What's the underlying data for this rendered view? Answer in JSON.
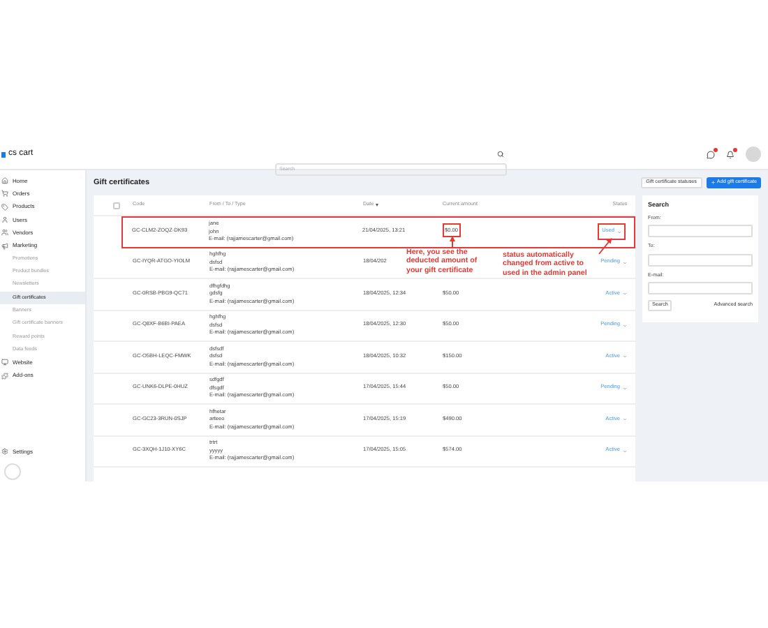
{
  "header": {
    "logo_text": "cs cart",
    "search": {
      "placeholder": "Search"
    }
  },
  "sidebar": {
    "items": [
      {
        "label": "Home",
        "selected": false
      },
      {
        "label": "Orders",
        "selected": false
      },
      {
        "label": "Products",
        "selected": false
      },
      {
        "label": "Users",
        "selected": false
      },
      {
        "label": "Vendors",
        "selected": false
      },
      {
        "label": "Marketing",
        "selected": false,
        "children": [
          {
            "label": "Promotions",
            "selected": false
          },
          {
            "label": "Product bundles",
            "selected": false
          },
          {
            "label": "Newsletters",
            "selected": false
          },
          {
            "label": "Gift certificates",
            "selected": true
          },
          {
            "label": "Banners",
            "selected": false
          },
          {
            "label": "Gift certificate banners",
            "selected": false
          },
          {
            "label": "Reward points",
            "selected": false
          },
          {
            "label": "Data feeds",
            "selected": false
          }
        ]
      },
      {
        "label": "Website",
        "selected": false
      },
      {
        "label": "Add-ons",
        "selected": false
      }
    ],
    "settings": {
      "label": "Settings"
    }
  },
  "page": {
    "title": "Gift certificates",
    "buttons": [
      {
        "label": "Gift certificate statuses",
        "kind": "secondary"
      },
      {
        "label": "Add gift certificate",
        "kind": "primary"
      }
    ]
  },
  "table": {
    "select_all": {
      "checked": false
    },
    "columns": [
      "Code",
      "From / To / Type",
      "Date",
      "Current amount",
      "Status"
    ],
    "rows": [
      {
        "code": "GC-CLM2-ZOQZ-DK93",
        "from": "jane",
        "to": "john",
        "type": "E-mail: (rajjamescarter@gmail.com)",
        "date": "21/04/2025, 13:21",
        "amount": "$0.00",
        "status": "Used",
        "marked": true
      },
      {
        "code": "GC-IYQR-ATGO-YIOLM",
        "from": "hghfhg",
        "to": "dsfsd",
        "type": "E-mail: (rajjamescarter@gmail.com)",
        "date": "18/04/202",
        "status": "Pending",
        "marked": false
      },
      {
        "code": "GC-0RSB-PBG9-QC71",
        "from": "dfhgfdhg",
        "to": "gdsfg",
        "type": "E-mail: (rajjamescarter@gmail.com)",
        "date": "18/04/2025, 12:34",
        "amount": "$50.00",
        "status": "Active",
        "marked": false
      },
      {
        "code": "GC-Q8XF-B6BI-PAEA",
        "from": "hghfhg",
        "to": "dsfsd",
        "type": "E-mail: (rajjamescarter@gmail.com)",
        "date": "18/04/2025, 12:30",
        "amount": "$50.00",
        "status": "Pending",
        "marked": false
      },
      {
        "code": "GC-O5BH-LEQC-FMWK",
        "from": "dsfsdf",
        "to": "dsfsd",
        "type": "E-mail: (rajjamescarter@gmail.com)",
        "date": "18/04/2025, 10:32",
        "amount": "$150.00",
        "status": "Active",
        "marked": false
      },
      {
        "code": "GC-UNK6-DLPE-0HUZ",
        "from": "sdfgdf",
        "to": "dfsgdf",
        "type": "E-mail: (rajjamescarter@gmail.com)",
        "date": "17/04/2025, 15:44",
        "amount": "$50.00",
        "status": "Pending",
        "marked": false
      },
      {
        "code": "GC-GC23-3RUN-0SJP",
        "from": "hfhetar",
        "to": "arteeo",
        "type": "E-mail: (rajjamescarter@gmail.com)",
        "date": "17/04/2025, 15:19",
        "amount": "$490.00",
        "status": "Active",
        "marked": false
      },
      {
        "code": "GC-3XQH-1J10-XY6C",
        "from": "trtrt",
        "to": "yyyyy",
        "type": "E-mail: (rajjamescarter@gmail.com)",
        "date": "17/04/2025, 15:05",
        "amount": "$574.00",
        "status": "Active",
        "marked": false
      }
    ]
  },
  "annotations": [
    {
      "text": "Here, you see the deducted amount of your gift certificate"
    },
    {
      "text": "status automatically changed from active to used in the admin panel"
    }
  ],
  "search_panel": {
    "title": "Search",
    "fields": [
      {
        "label": "From:"
      },
      {
        "label": "To:"
      },
      {
        "label": "E-mail:"
      }
    ],
    "button": "Search",
    "link": "Advanced search"
  }
}
